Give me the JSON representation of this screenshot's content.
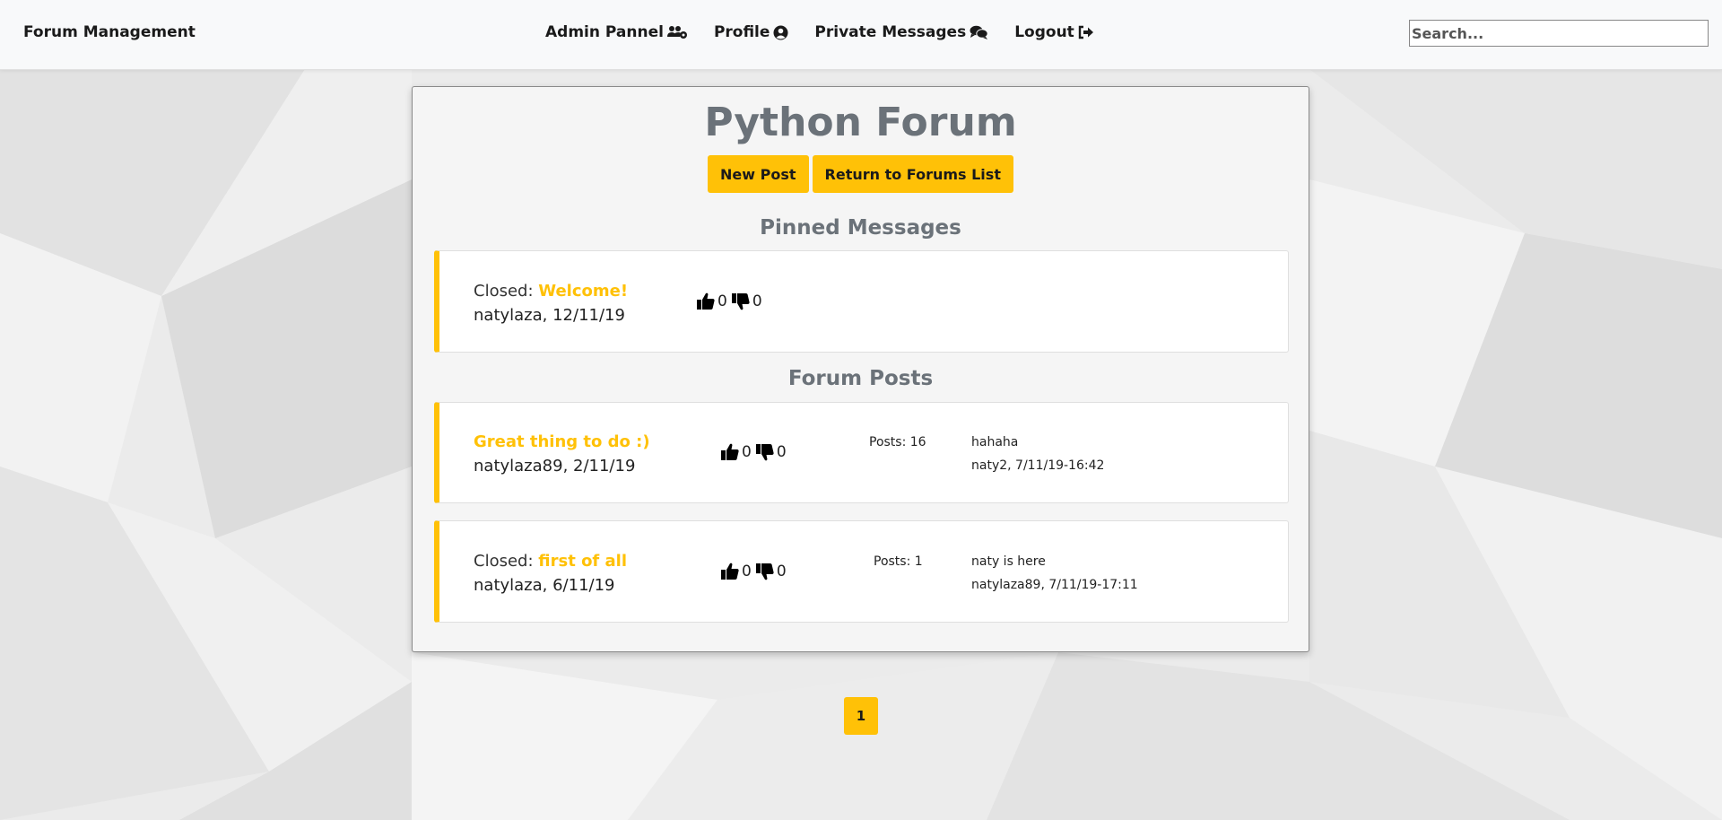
{
  "navbar": {
    "brand": "Forum Management",
    "links": [
      {
        "label": "Admin Pannel",
        "icon": "users-cog-icon"
      },
      {
        "label": "Profile",
        "icon": "user-circle-icon"
      },
      {
        "label": "Private Messages",
        "icon": "comments-icon"
      },
      {
        "label": "Logout",
        "icon": "sign-out-icon"
      }
    ],
    "search_placeholder": "Search..."
  },
  "forum": {
    "title": "Python Forum",
    "new_post_label": "New Post",
    "return_label": "Return to Forums List"
  },
  "pinned": {
    "heading": "Pinned Messages",
    "items": [
      {
        "status": "Closed:",
        "title": "Welcome!",
        "author_date": "natylaza, 12/11/19",
        "likes": "0",
        "dislikes": "0"
      }
    ]
  },
  "posts": {
    "heading": "Forum Posts",
    "items": [
      {
        "status": "",
        "title": "Great thing to do :)",
        "author_date": "natylaza89, 2/11/19",
        "likes": "0",
        "dislikes": "0",
        "posts_count": "Posts: 16",
        "last_message": "hahaha",
        "last_by": "naty2, 7/11/19-16:42"
      },
      {
        "status": "Closed:",
        "title": "first of all",
        "author_date": "natylaza, 6/11/19",
        "likes": "0",
        "dislikes": "0",
        "posts_count": "Posts: 1",
        "last_message": "naty is here",
        "last_by": "natylaza89, 7/11/19-17:11"
      }
    ]
  },
  "pagination": {
    "current": "1"
  },
  "colors": {
    "accent": "#ffc107",
    "heading": "#6b7279",
    "navbar_bg": "#f8f9fa"
  }
}
